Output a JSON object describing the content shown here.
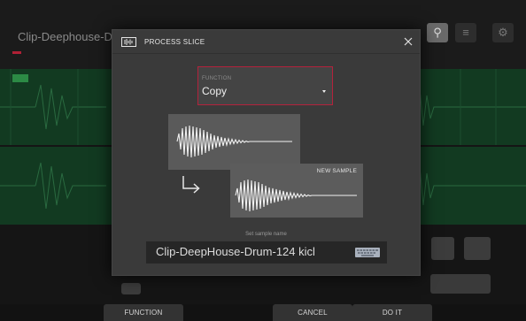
{
  "background": {
    "track_title": "Clip-Deephouse-Dr",
    "header_buttons": [
      {
        "icon": "search-icon",
        "highlighted": true
      },
      {
        "icon": "grid-icon",
        "highlighted": false
      },
      {
        "icon": "gear-icon",
        "highlighted": false
      }
    ]
  },
  "dialog": {
    "title": "PROCESS SLICE",
    "icon": "waveform-icon",
    "close_icon": "close-icon",
    "function_label": "FUNCTION",
    "function_value": "Copy",
    "new_sample_label": "NEW SAMPLE",
    "sample_name_label": "Set sample name",
    "sample_name_value": "Clip-DeepHouse-Drum-124 kicl",
    "keyboard_icon": "keyboard-icon"
  },
  "function_bar": {
    "function_label": "FUNCTION",
    "cancel_label": "CANCEL",
    "do_it_label": "DO IT"
  },
  "colors": {
    "accent_red": "#b4223c",
    "background_wave_green": "#123a21",
    "dialog_background": "#3a3a3a"
  }
}
